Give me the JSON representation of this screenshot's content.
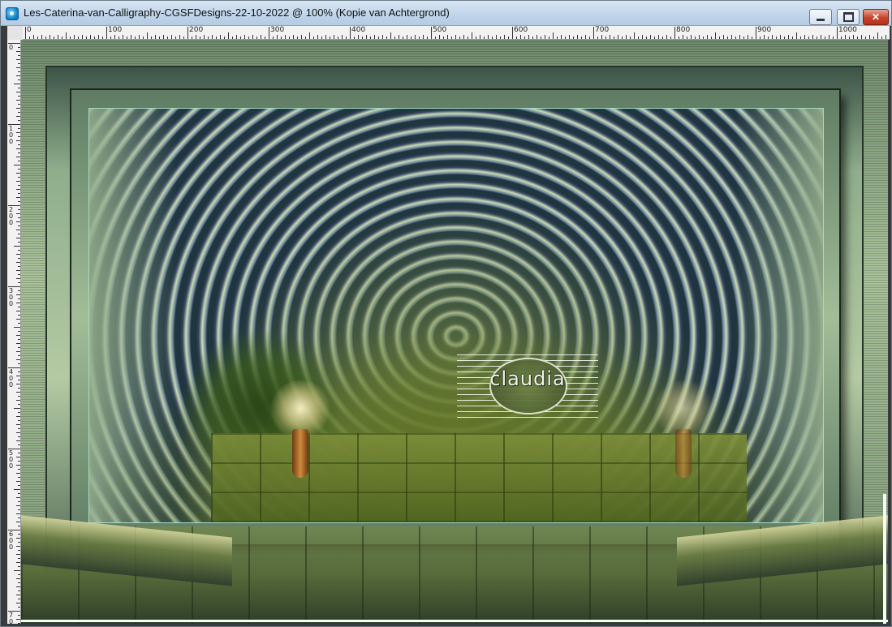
{
  "window": {
    "title": "Les-Caterina-van-Calligraphy-CGSFDesigns-22-10-2022 @ 100% (Kopie van Achtergrond)",
    "icon": "image-icon",
    "controls": {
      "minimize": "minimize-icon",
      "maximize": "maximize-icon",
      "close": "close-icon"
    }
  },
  "ruler": {
    "top_labels": [
      "0",
      "100",
      "200",
      "300",
      "400",
      "500",
      "600",
      "700",
      "800",
      "900",
      "1000"
    ],
    "left_labels": [
      "0",
      "100",
      "200",
      "300",
      "400",
      "500",
      "600",
      "700"
    ]
  },
  "canvas": {
    "watermark_text": "claudia",
    "colors": {
      "accent": "#a3dcc4",
      "frame": "#8fae8c",
      "rings": "#3b4762"
    }
  }
}
